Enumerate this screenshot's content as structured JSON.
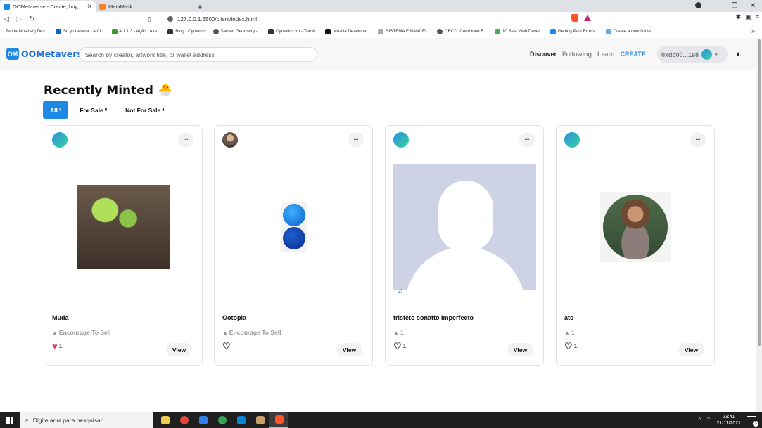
{
  "browser": {
    "tabs": [
      {
        "title": "OOMetaverse - Create, buy, and s",
        "close": "✕"
      },
      {
        "title": "MetaMask"
      }
    ],
    "new_tab": "+",
    "url": "127.0.0.1:5500/client/index.html",
    "window_controls": {
      "minimize": "–",
      "restore": "❐",
      "close": "✕"
    },
    "bookmarks": [
      "Teoria Musical | Des...",
      "Sri yukteswar - A Ci...",
      "4.1.1.3 - Ação / Ave...",
      "Blog - Cymatics",
      "Sacred Geometry -...",
      "Cymatics.fm - The #...",
      "Mozilla Developer...",
      "SISTEMA FINANCEI...",
      "CRCD: Combined R...",
      "10 Best Web Devel...",
      "Getting Past Errors...",
      "Create a new fiddle..."
    ],
    "bookmarks_more": "»"
  },
  "header": {
    "logo_badge": "OM",
    "logo_text": "OOMetaverse",
    "search_placeholder": "Search by creator, artwork title, or wallet address",
    "nav": {
      "discover": "Discover",
      "following": "Following",
      "learn": "Learn",
      "create": "CREATE"
    },
    "wallet_address": "0xdc00...1e8"
  },
  "section": {
    "title": "Recently Minted",
    "title_icon": "hatching-egg-icon",
    "filters": [
      {
        "label": "All",
        "count": "4",
        "active": true
      },
      {
        "label": "For Sale",
        "count": "0",
        "active": false
      },
      {
        "label": "Not For Sale",
        "count": "4",
        "active": false
      }
    ]
  },
  "cards": [
    {
      "name": "Muda",
      "status": "Encourage To Sell",
      "likes": "1",
      "liked": true,
      "view": "View",
      "menu": "...",
      "art": "sprout-image",
      "avatar": "gradient-avatar"
    },
    {
      "name": "Ootopia",
      "status": "Encourage To Sell",
      "likes": "",
      "liked": false,
      "view": "View",
      "menu": "...",
      "art": "blue-spheres-image",
      "avatar": "photo-avatar"
    },
    {
      "name": "tristeto sonatto imperfecto",
      "status": "1",
      "likes": "1",
      "liked": false,
      "view": "View",
      "menu": "...",
      "art": "profile-silhouette-image",
      "avatar": "gradient-avatar",
      "media_icon": "music-note-icon"
    },
    {
      "name": "ats",
      "status": "1",
      "likes": "1",
      "liked": false,
      "view": "View",
      "menu": "...",
      "art": "portrait-photo-image",
      "avatar": "gradient-avatar"
    }
  ],
  "taskbar": {
    "search_placeholder": "Digite aqui para pesquisar",
    "time": "23:41",
    "date": "21/11/2021",
    "notifications": "3"
  },
  "colors": {
    "accent": "#1e88e5",
    "liked_heart": "#e53966",
    "muted_text": "#9a9a9a"
  }
}
